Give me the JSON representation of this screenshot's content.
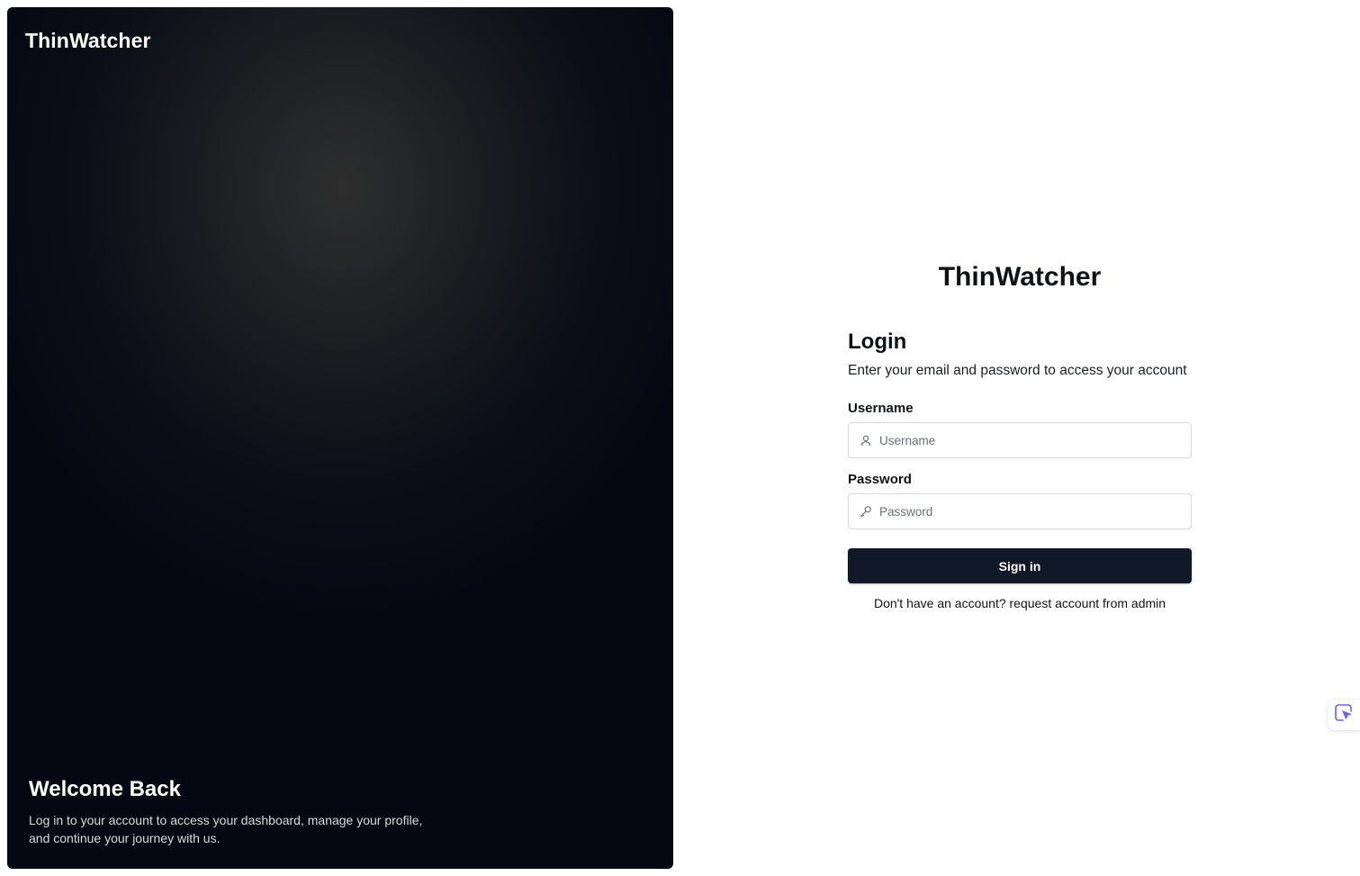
{
  "hero": {
    "logo": "ThinWatcher",
    "title": "Welcome Back",
    "description_line1": "Log in to your account to access your dashboard, manage your profile,",
    "description_line2": "and continue your journey with us."
  },
  "login": {
    "brand": "ThinWatcher",
    "title": "Login",
    "subtitle": "Enter your email and password to access your account",
    "username_label": "Username",
    "username_placeholder": "Username",
    "username_value": "",
    "username_icon": "user-icon",
    "password_label": "Password",
    "password_placeholder": "Password",
    "password_value": "",
    "password_icon": "key-icon",
    "signin_label": "Sign in",
    "footnote": "Don't have an account? request account from admin"
  },
  "widget": {
    "icon": "cursor-select-icon",
    "accent": "#6d5dfc"
  },
  "colors": {
    "hero_bg": "#050812",
    "button_bg": "#111827",
    "input_border": "#d5d8dd"
  }
}
